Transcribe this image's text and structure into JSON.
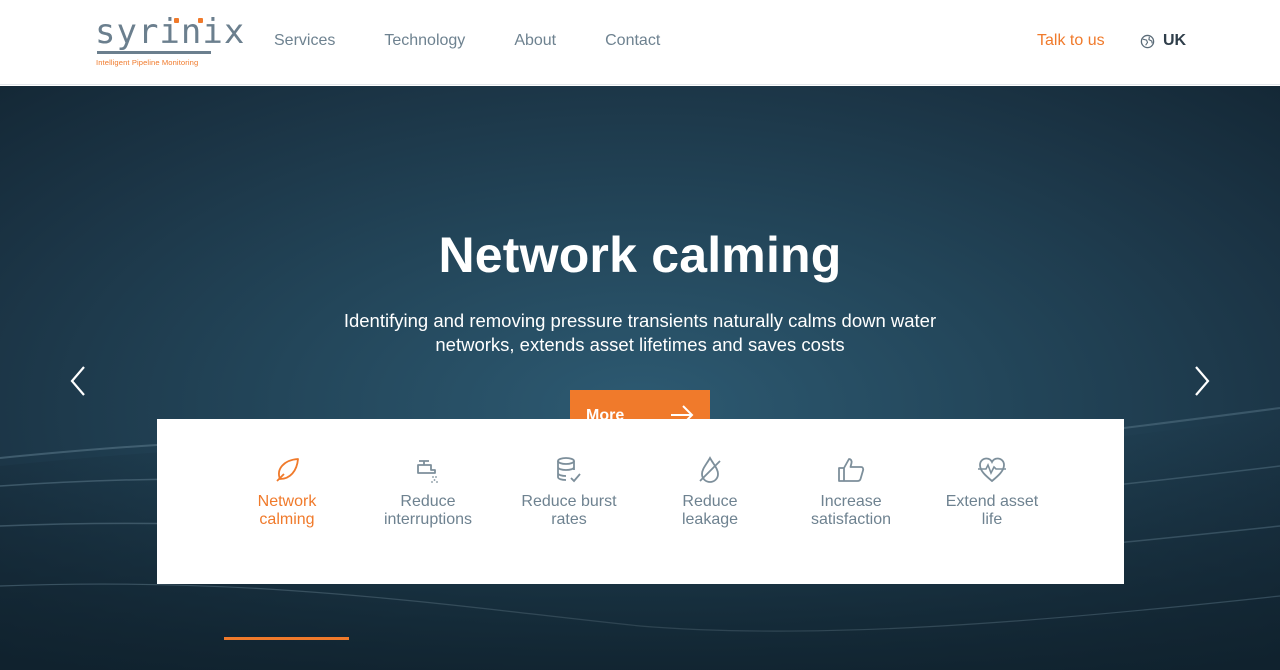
{
  "brand": {
    "name": "Syrinix",
    "logo_text": "syrinix",
    "tagline": "Intelligent Pipeline Monitoring",
    "accent": "#f07a2b",
    "slate": "#6e8290"
  },
  "nav": {
    "items": [
      {
        "label": "Services"
      },
      {
        "label": "Technology"
      },
      {
        "label": "About"
      },
      {
        "label": "Contact"
      }
    ],
    "cta_label": "Talk to us",
    "region_label": "UK",
    "region_icon": "globe-icon"
  },
  "hero": {
    "title": "Network calming",
    "subtitle": "Identifying and removing pressure transients naturally calms down water networks, extends asset lifetimes and saves costs",
    "button_label": "More",
    "button_icon": "arrow-right-icon",
    "prev_icon": "chevron-left-icon",
    "next_icon": "chevron-right-icon"
  },
  "features": [
    {
      "label": "Network calming",
      "icon": "leaf-icon",
      "active": true
    },
    {
      "label": "Reduce interruptions",
      "icon": "tap-icon",
      "active": false
    },
    {
      "label": "Reduce burst rates",
      "icon": "database-check-icon",
      "active": false
    },
    {
      "label": "Reduce leakage",
      "icon": "no-drop-icon",
      "active": false
    },
    {
      "label": "Increase satisfaction",
      "icon": "thumbs-up-icon",
      "active": false
    },
    {
      "label": "Extend asset life",
      "icon": "heartbeat-icon",
      "active": false
    }
  ]
}
